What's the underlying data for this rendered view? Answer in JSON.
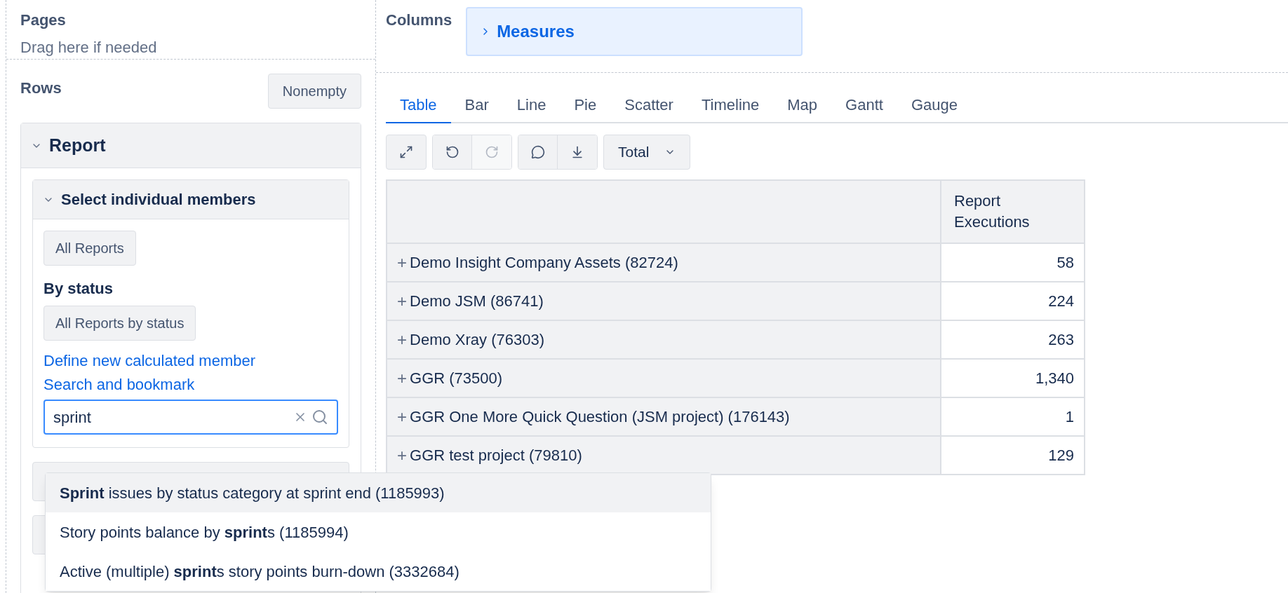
{
  "pages": {
    "title": "Pages",
    "hint": "Drag here if needed"
  },
  "columns": {
    "title": "Columns",
    "items": [
      {
        "label": "Measures",
        "expanded": false
      }
    ]
  },
  "rows": {
    "title": "Rows",
    "nonempty_button": "Nonempty",
    "panel": {
      "title": "Report",
      "expanded": true,
      "section": {
        "title": "Select individual members",
        "expanded": true,
        "all_button": "All Reports",
        "by_status_label": "By status",
        "by_status_button": "All Reports by status",
        "links": [
          "Define new calculated member",
          "Search and bookmark"
        ],
        "search": {
          "value": "sprint"
        },
        "suggestions": [
          {
            "text": "**Sprint** issues by status category at sprint end (1185993)",
            "selected": true
          },
          {
            "text": "Story points balance by **sprint**s (1185994)",
            "selected": false
          },
          {
            "text": "Active (multiple) **sprint**s story points burn-down (3332684)",
            "selected": false
          }
        ]
      }
    }
  },
  "tabs": [
    {
      "label": "Table",
      "selected": true
    },
    {
      "label": "Bar",
      "selected": false
    },
    {
      "label": "Line",
      "selected": false
    },
    {
      "label": "Pie",
      "selected": false
    },
    {
      "label": "Scatter",
      "selected": false
    },
    {
      "label": "Timeline",
      "selected": false
    },
    {
      "label": "Map",
      "selected": false
    },
    {
      "label": "Gantt",
      "selected": false
    },
    {
      "label": "Gauge",
      "selected": false
    }
  ],
  "toolbar": {
    "undo_disabled": false,
    "redo_disabled": true,
    "total_dropdown": "Total"
  },
  "table": {
    "columns": [
      "Report Executions"
    ],
    "rows": [
      {
        "label": "+",
        "name": "Demo Insight Company Assets (82724)",
        "value": "58"
      },
      {
        "label": "+",
        "name": "Demo JSM (86741)",
        "value": "224"
      },
      {
        "label": "+",
        "name": "Demo Xray (76303)",
        "value": "263"
      },
      {
        "label": "+",
        "name": "GGR (73500)",
        "value": "1,340"
      },
      {
        "label": "+",
        "name": "GGR One More Quick Question (JSM project) (176143)",
        "value": "1"
      },
      {
        "label": "+",
        "name": "GGR test project (79810)",
        "value": "129"
      }
    ]
  }
}
